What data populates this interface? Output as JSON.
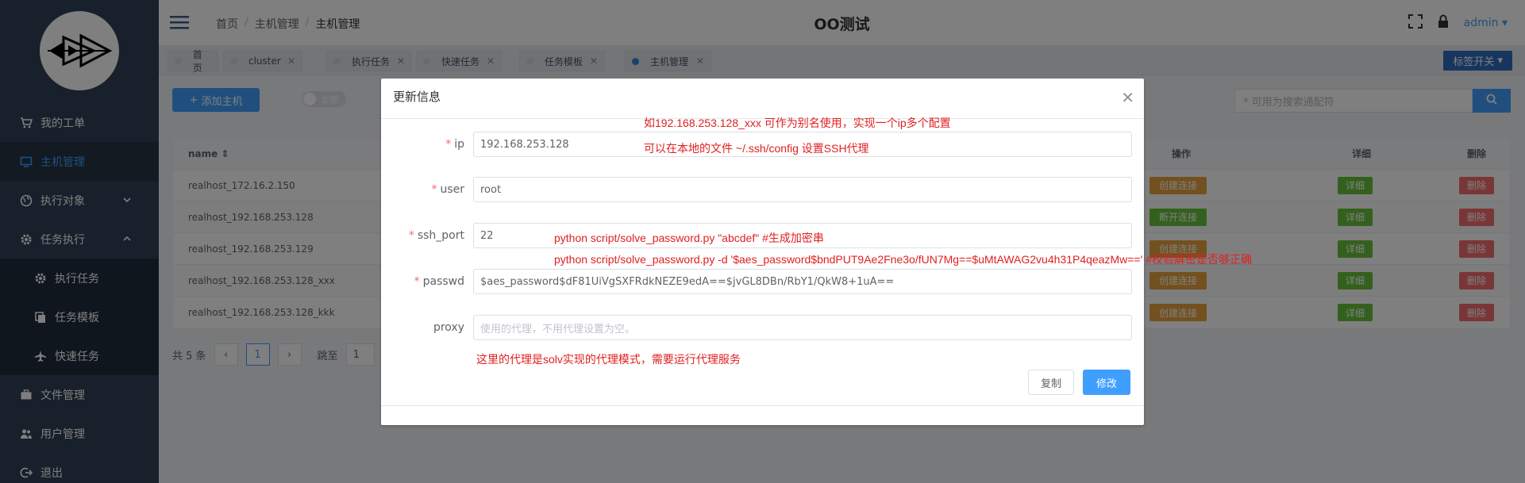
{
  "sidebar": {
    "items": [
      {
        "label": "我的工单",
        "icon": "cart-icon"
      },
      {
        "label": "主机管理",
        "icon": "monitor-icon"
      },
      {
        "label": "执行对象",
        "icon": "globe-icon"
      },
      {
        "label": "任务执行",
        "icon": "gear-icon"
      },
      {
        "label": "执行任务",
        "icon": "gear-icon"
      },
      {
        "label": "任务模板",
        "icon": "copy-icon"
      },
      {
        "label": "快速任务",
        "icon": "plane-icon"
      },
      {
        "label": "文件管理",
        "icon": "briefcase-icon"
      },
      {
        "label": "用户管理",
        "icon": "users-icon"
      },
      {
        "label": "退出",
        "icon": "logout-icon"
      }
    ]
  },
  "navbar": {
    "breadcrumb": [
      "首页",
      "主机管理",
      "主机管理"
    ],
    "title": "OO测试",
    "user": "admin"
  },
  "tags": [
    {
      "label": "首页"
    },
    {
      "label": "cluster"
    },
    {
      "label": "执行任务"
    },
    {
      "label": "快速任务"
    },
    {
      "label": "任务模板"
    },
    {
      "label": "主机管理"
    }
  ],
  "tag_switch": "标签开关",
  "main": {
    "add_button": "添加主机",
    "toggle_label": "全部",
    "search_placeholder": "* 可用为搜索通配符",
    "columns": {
      "name": "name",
      "op": "操作",
      "detail": "详细",
      "del": "删除"
    },
    "rows": [
      {
        "name": "realhost_172.16.2.150",
        "op": "创建连接"
      },
      {
        "name": "realhost_192.168.253.128",
        "op": "断开连接"
      },
      {
        "name": "realhost_192.168.253.129",
        "op": "创建连接"
      },
      {
        "name": "realhost_192.168.253.128_xxx",
        "op": "创建连接"
      },
      {
        "name": "realhost_192.168.253.128_kkk",
        "op": "创建连接"
      }
    ],
    "detail_label": "详细",
    "delete_label": "删除",
    "pager": {
      "total": "共 5 条",
      "current": "1",
      "jump_label": "跳至",
      "jump_value": "1"
    }
  },
  "dialog": {
    "title": "更新信息",
    "fields": {
      "ip": {
        "label": "ip",
        "value": "192.168.253.128"
      },
      "user": {
        "label": "user",
        "value": "root"
      },
      "ssh_port": {
        "label": "ssh_port",
        "value": "22"
      },
      "passwd": {
        "label": "passwd",
        "value": "$aes_password$dF81UiVgSXFRdkNEZE9edA==$jvGL8DBn/RbY1/QkW8+1uA=="
      },
      "proxy": {
        "label": "proxy",
        "placeholder": "使用的代理，不用代理设置为空。"
      }
    },
    "notes": {
      "alias": "如192.168.253.128_xxx 可作为别名使用，实现一个ip多个配置",
      "ssh_config": "可以在本地的文件 ~/.ssh/config 设置SSH代理",
      "gen": "python script/solve_password.py \"abcdef\"   #生成加密串",
      "verify": "python script/solve_password.py -d '$aes_password$bndPUT9Ae2Fne3o/fUN7Mg==$uMtAWAG2vu4h31P4qeazMw=='   #校验解密是否够正确",
      "proxy": "这里的代理是solv实现的代理模式，需要运行代理服务"
    },
    "copy_button": "复制",
    "edit_button": "修改"
  }
}
